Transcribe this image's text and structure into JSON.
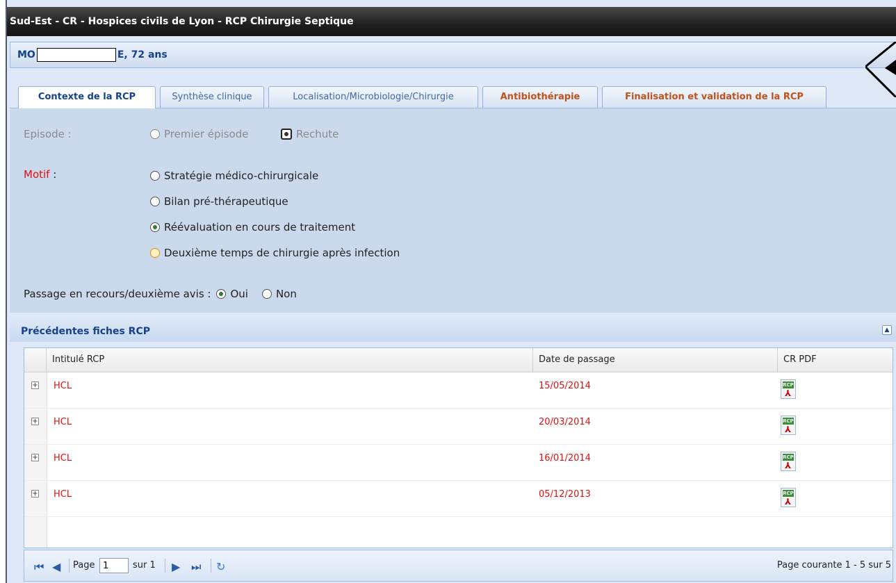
{
  "window": {
    "title": "Sud-Est - CR - Hospices civils de Lyon - RCP Chirurgie Septique"
  },
  "patient": {
    "prefix": "MO",
    "suffix": "E, 72 ans"
  },
  "tabs": [
    {
      "label": "Contexte de la RCP",
      "active": true
    },
    {
      "label": "Synthèse clinique"
    },
    {
      "label": "Localisation/Microbiologie/Chirurgie"
    },
    {
      "label": "Antibiothérapie"
    },
    {
      "label": "Finalisation et validation de la RCP"
    }
  ],
  "form": {
    "episode_label": "Episode :",
    "episode_options": [
      "Premier épisode",
      "Rechute"
    ],
    "episode_selected": "Rechute",
    "motif_label": "Motif",
    "motif_colon": " :",
    "motif_options": [
      "Stratégie médico-chirurgicale",
      "Bilan pré-thérapeutique",
      "Réévaluation en cours de traitement",
      "Deuxième temps de chirurgie après infection"
    ],
    "motif_selected": "Réévaluation en cours de traitement",
    "passage_label": "Passage en recours/deuxième avis :",
    "passage_options": [
      "Oui",
      "Non"
    ],
    "passage_selected": "Oui"
  },
  "grid": {
    "title": "Précédentes fiches RCP",
    "columns": [
      "Intitulé RCP",
      "Date de passage",
      "CR PDF"
    ],
    "rows": [
      {
        "intitule": "HCL",
        "date": "15/05/2014"
      },
      {
        "intitule": "HCL",
        "date": "20/03/2014"
      },
      {
        "intitule": "HCL",
        "date": "16/01/2014"
      },
      {
        "intitule": "HCL",
        "date": "05/12/2013"
      }
    ],
    "pdf_icon_label": "RCP"
  },
  "pager": {
    "page_label": "Page",
    "page_value": "1",
    "of_label": "sur 1",
    "status": "Page courante 1 - 5 sur 5"
  }
}
